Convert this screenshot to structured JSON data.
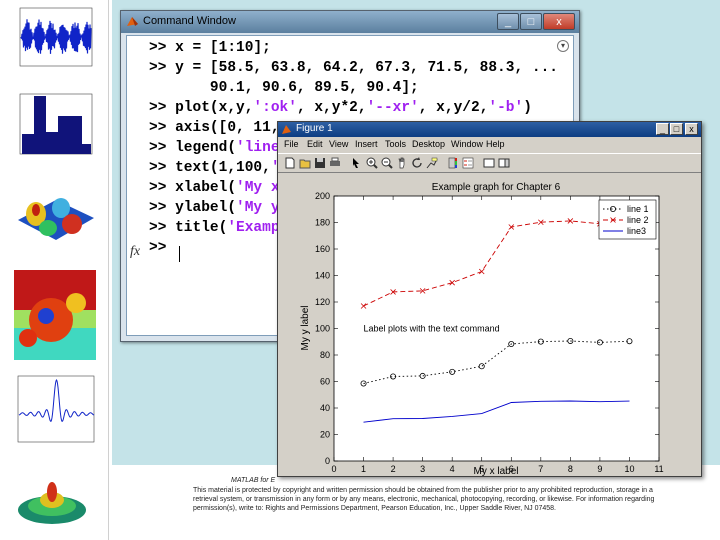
{
  "command_window": {
    "title": "Command Window",
    "lines": [
      ">> x = [1:10];",
      ">> y = [58.5, 63.8, 64.2, 67.3, 71.5, 88.3, ...",
      "       90.1, 90.6, 89.5, 90.4];",
      ">> plot(x,y,':ok', x,y*2,'--xr', x,y/2,'-b')",
      ">> axis([0, 11, ",
      ">> legend('line",
      ">> text(1,100,'",
      ">> xlabel('My x",
      ">> ylabel('My y",
      ">> title('Exampl",
      ">> "
    ],
    "prompt_icon": "fx",
    "minimize": "_",
    "maximize": "□",
    "close": "x"
  },
  "figure_window": {
    "title": "Figure 1",
    "menus": [
      "File",
      "Edit",
      "View",
      "Insert",
      "Tools",
      "Desktop",
      "Window",
      "Help"
    ],
    "toolbar_icons": [
      "new-file-icon",
      "open-folder-icon",
      "save-icon",
      "print-icon",
      "pointer-icon",
      "zoom-in-icon",
      "zoom-out-icon",
      "pan-icon",
      "rotate-icon",
      "datacursor-icon",
      "colorbar-icon",
      "legend-icon",
      "hide-plot-icon",
      "show-plot-icon"
    ]
  },
  "chart_data": {
    "type": "line",
    "title": "Example graph for Chapter 6",
    "xlabel": "My x label",
    "ylabel": "My y label",
    "xlim": [
      0,
      11
    ],
    "ylim": [
      0,
      200
    ],
    "xticks": [
      0,
      1,
      2,
      3,
      4,
      5,
      6,
      7,
      8,
      9,
      10,
      11
    ],
    "yticks": [
      0,
      20,
      40,
      60,
      80,
      100,
      120,
      140,
      160,
      180,
      200
    ],
    "grid": false,
    "legend_position": "top-right",
    "annotation": {
      "x": 1,
      "y": 100,
      "text": "Label plots with the text command"
    },
    "x": [
      1,
      2,
      3,
      4,
      5,
      6,
      7,
      8,
      9,
      10
    ],
    "series": [
      {
        "name": "line 1",
        "style": "dotted",
        "marker": "o",
        "color": "#000000",
        "values": [
          58.5,
          63.8,
          64.2,
          67.3,
          71.5,
          88.3,
          90.1,
          90.6,
          89.5,
          90.4
        ]
      },
      {
        "name": "line 2",
        "style": "dashed",
        "marker": "x",
        "color": "#cc0000",
        "values": [
          117.0,
          127.6,
          128.4,
          134.6,
          143.0,
          176.6,
          180.2,
          181.2,
          179.0,
          180.8
        ]
      },
      {
        "name": "line3",
        "style": "solid",
        "marker": "none",
        "color": "#0000cc",
        "values": [
          29.25,
          31.9,
          32.1,
          33.65,
          35.75,
          44.15,
          45.05,
          45.3,
          44.75,
          45.2
        ]
      }
    ]
  },
  "caption": {
    "line1": "MATLAB for E",
    "line2": "This material is protected by copyright and written permission should be obtained from the publisher prior to any prohibited reproduction, storage in a",
    "line3": "retrieval system, or transmission in any form or by any means, electronic, mechanical, photocopying, recording, or likewise. For information regarding",
    "line4": "permission(s), write to: Rights and Permissions Department, Pearson Education, Inc., Upper Saddle River, NJ 07458."
  }
}
